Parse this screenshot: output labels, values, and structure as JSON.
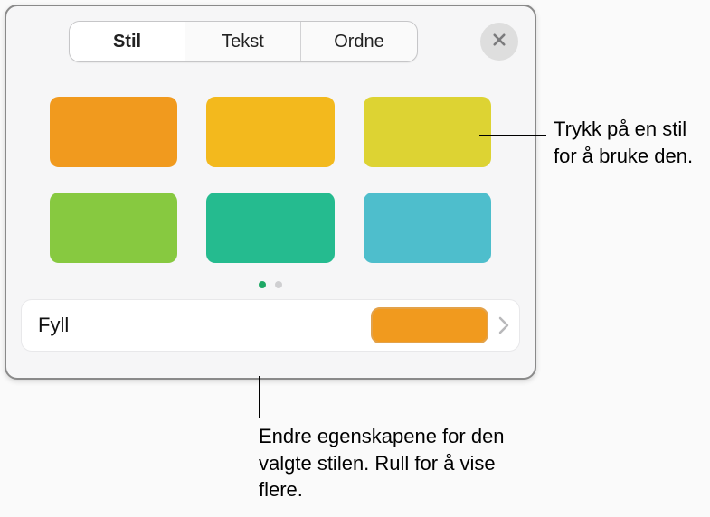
{
  "tabs": {
    "stil": "Stil",
    "tekst": "Tekst",
    "ordne": "Ordne"
  },
  "styles": [
    {
      "name": "style-orange",
      "color": "#f19a1e"
    },
    {
      "name": "style-yellow",
      "color": "#f3b91d"
    },
    {
      "name": "style-olive",
      "color": "#ddd333"
    },
    {
      "name": "style-green",
      "color": "#87c940"
    },
    {
      "name": "style-teal",
      "color": "#25bb8f"
    },
    {
      "name": "style-cyan",
      "color": "#4ebecc"
    }
  ],
  "pager": {
    "pages": 2,
    "active": 0
  },
  "fill": {
    "label": "Fyll",
    "preview_color": "#f19a1e"
  },
  "callouts": {
    "tap_style": "Trykk på en stil for å bruke den.",
    "change_props": "Endre egenskapene for den valgte stilen. Rull for å vise flere."
  }
}
